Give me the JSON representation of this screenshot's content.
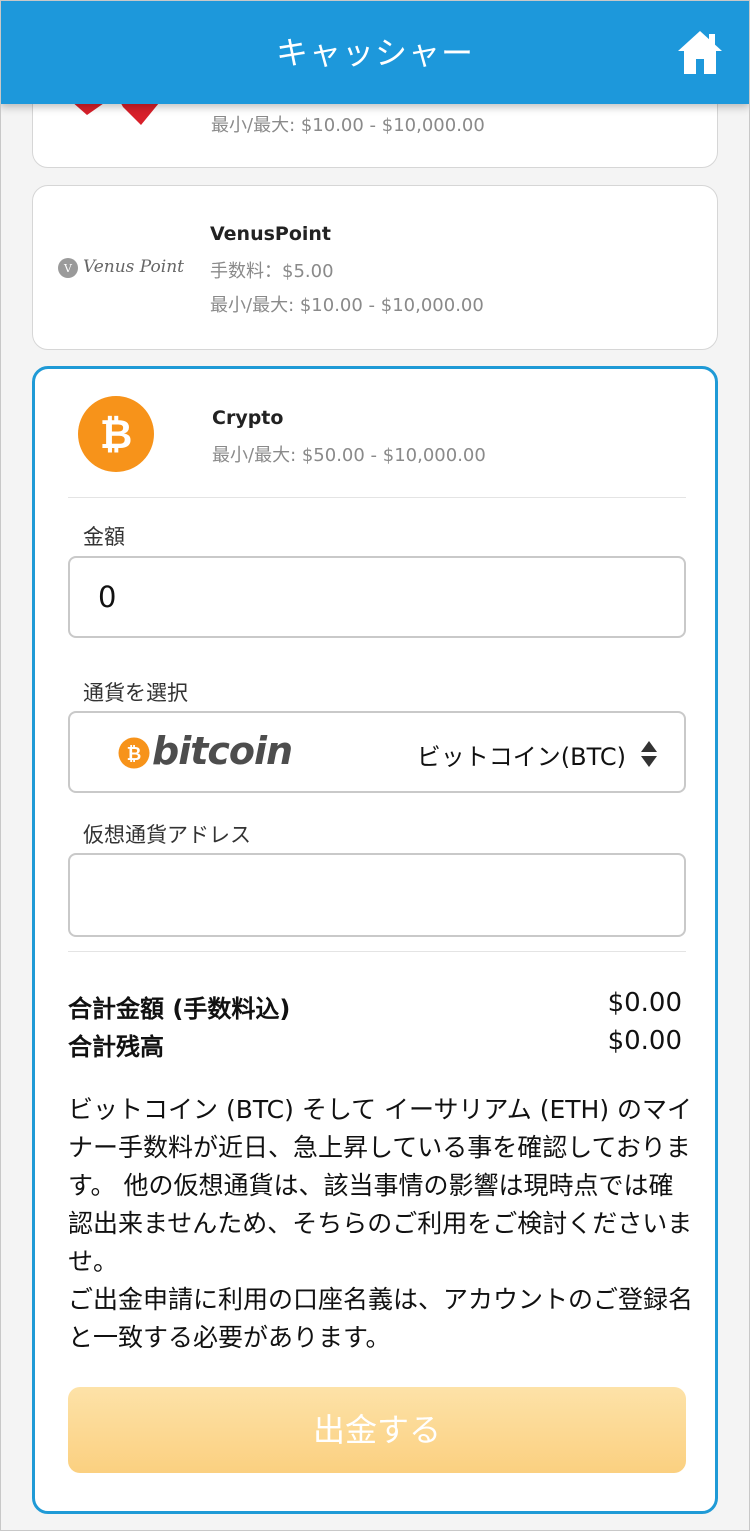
{
  "header": {
    "title": "キャッシャー"
  },
  "methods": [
    {
      "name": "",
      "range": "最小/最大: $10.00 - $10,000.00"
    },
    {
      "name": "VenusPoint",
      "logo_text": "Venus Point",
      "fee": "手数料：$5.00",
      "range": "最小/最大: $10.00 - $10,000.00"
    }
  ],
  "crypto": {
    "name": "Crypto",
    "range": "最小/最大: $50.00 - $10,000.00",
    "amount_label": "金額",
    "amount_value": "0",
    "currency_label": "通貨を選択",
    "currency_logo_text": "bitcoin",
    "currency_selected": "ビットコイン(BTC)",
    "address_label": "仮想通貨アドレス",
    "address_value": ""
  },
  "summary": {
    "total_label": "合計金額 (手数料込)",
    "total_value": "$0.00",
    "balance_label": "合計残高",
    "balance_value": "$0.00"
  },
  "notice": {
    "p1": "ビットコイン (BTC) そして イーサリアム (ETH) のマイナー手数料が近日、急上昇している事を確認しております。 他の仮想通貨は、該当事情の影響は現時点では確認出来ませんため、そちらのご利用をご検討くださいませ。",
    "p2": "ご出金申請に利用の口座名義は、アカウントのご登録名と一致する必要があります。"
  },
  "submit_label": "出金する",
  "colors": {
    "header": "#1d98db",
    "active_border": "#1f9ad6",
    "submit": "#fbd080",
    "bitcoin": "#f7931a"
  }
}
